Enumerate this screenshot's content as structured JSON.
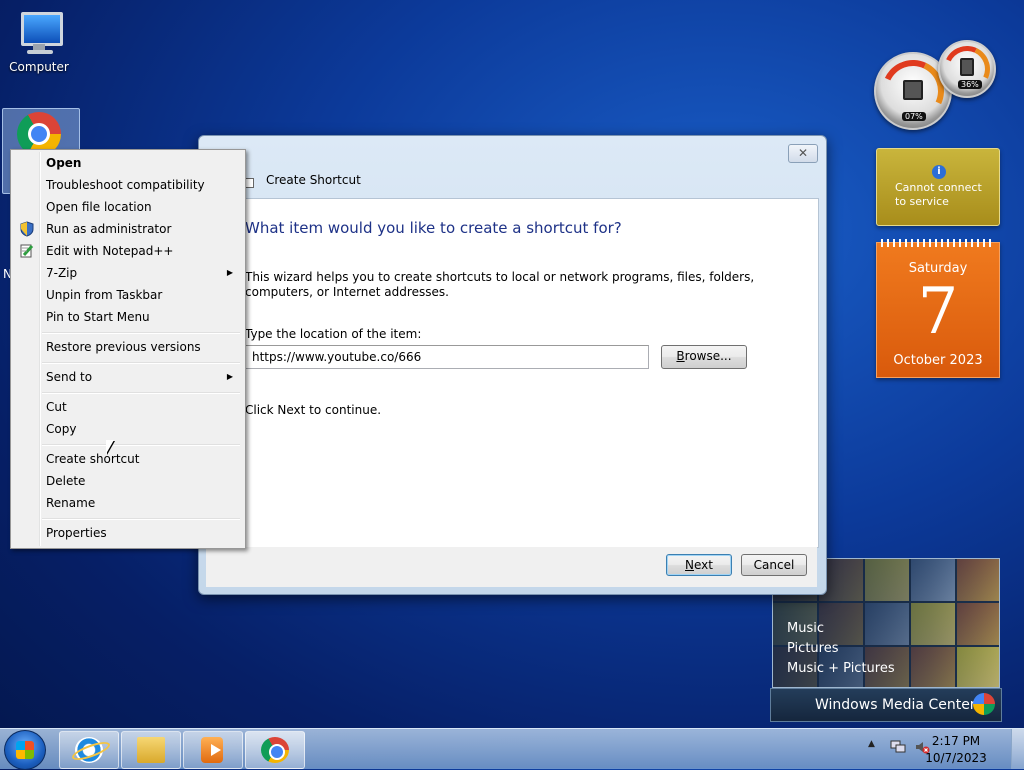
{
  "desktop": {
    "icons": [
      {
        "label": "Computer",
        "icon": "computer-icon"
      },
      {
        "label": "",
        "icon": "chrome-icon"
      }
    ],
    "chrome_icon_label_partial": "N"
  },
  "gadgets": {
    "cpu_meter": {
      "cpu": "07%",
      "memory": "36%"
    },
    "weather": {
      "message_line1": "Cannot connect",
      "message_line2": "to service",
      "icon": "info-icon"
    },
    "calendar": {
      "weekday": "Saturday",
      "day": "7",
      "month_year": "October 2023"
    },
    "media_center": {
      "items": [
        "Music",
        "Pictures",
        "Music + Pictures"
      ],
      "title": "Windows Media Center"
    }
  },
  "dialog": {
    "title": "Create Shortcut",
    "close_label": "✕",
    "heading": "What item would you like to create a shortcut for?",
    "description": "This wizard helps you to create shortcuts to local or network programs, files, folders, computers, or Internet addresses.",
    "location_label": "Type the location of the item:",
    "location_value": "https://www.youtube.co/666",
    "browse_label": "Browse...",
    "continue_text": "Click Next to continue.",
    "next_label": "Next",
    "cancel_label": "Cancel"
  },
  "context_menu": {
    "items": [
      {
        "label": "Open",
        "bold": true
      },
      {
        "label": "Troubleshoot compatibility"
      },
      {
        "label": "Open file location"
      },
      {
        "label": "Run as administrator",
        "icon": "shield-icon"
      },
      {
        "label": "Edit with Notepad++",
        "icon": "notepad-icon"
      },
      {
        "label": "7-Zip",
        "submenu": true
      },
      {
        "label": "Unpin from Taskbar"
      },
      {
        "label": "Pin to Start Menu"
      },
      {
        "label": "Restore previous versions"
      },
      {
        "label": "Send to",
        "submenu": true
      },
      {
        "label": "Cut"
      },
      {
        "label": "Copy"
      },
      {
        "label": "Create shortcut"
      },
      {
        "label": "Delete"
      },
      {
        "label": "Rename"
      },
      {
        "label": "Properties"
      }
    ],
    "submenu_arrow": "▶"
  },
  "taskbar": {
    "pinned": [
      {
        "name": "internet-explorer-icon"
      },
      {
        "name": "windows-explorer-icon"
      },
      {
        "name": "windows-media-player-icon"
      },
      {
        "name": "chrome-icon"
      }
    ],
    "tray": {
      "time": "2:17 PM",
      "date": "10/7/2023",
      "show_hidden": "▲"
    }
  }
}
